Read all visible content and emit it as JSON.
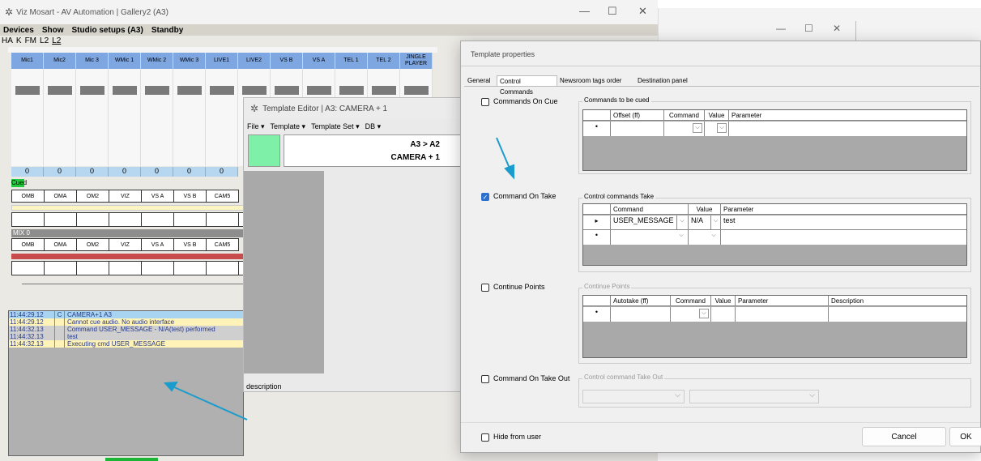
{
  "main_window": {
    "title": "Viz Mosart - AV Automation | Gallery2 (A3)",
    "menu": [
      "Devices",
      "Show",
      "Studio setups (A3)",
      "Standby"
    ],
    "subbar": [
      "HA",
      "K",
      "FM",
      "L2",
      "L2"
    ],
    "channels": [
      "Mic1",
      "Mic2",
      "Mic 3",
      "WMic 1",
      "WMic 2",
      "WMic 3",
      "LIVE1",
      "LIVE2",
      "VS B",
      "VS A",
      "TEL 1",
      "TEL 2",
      "JINGLE PLAYER"
    ],
    "channel_values": [
      "0",
      "0",
      "0",
      "0",
      "0",
      "0",
      "0"
    ],
    "cued_label": "Cued",
    "cued_buttons": [
      "OMB",
      "OMA",
      "OM2",
      "VIZ",
      "VS A",
      "VS B",
      "CAM5"
    ],
    "mix_label": "MIX 0",
    "mix_buttons": [
      "OMB",
      "OMA",
      "OM2",
      "VIZ",
      "VS A",
      "VS B",
      "CAM5"
    ]
  },
  "log": {
    "rows": [
      {
        "time": "11:44:29.12",
        "code": "C",
        "msg": "CAMERA+1 A3",
        "bg": "#a8d4f2"
      },
      {
        "time": "11:44:29.12",
        "code": "",
        "msg": "Cannot cue audio. No audio interface",
        "bg": "#fff3b8"
      },
      {
        "time": "11:44:32.13",
        "code": "",
        "msg": "Command USER_MESSAGE - N/A(test) performed",
        "bg": "#cfcfcf"
      },
      {
        "time": "11:44:32.13",
        "code": "",
        "msg": "test",
        "bg": "#cfcfcf"
      },
      {
        "time": "11:44:32.13",
        "code": "",
        "msg": "Executing cmd USER_MESSAGE",
        "bg": "#fff3b8"
      }
    ]
  },
  "template_editor": {
    "title": "Template Editor | A3: CAMERA + 1",
    "menu": [
      "File ▾",
      "Template ▾",
      "Template Set ▾",
      "DB ▾"
    ],
    "line1": "A3 > A2",
    "line2": "CAMERA + 1",
    "description_label": "description"
  },
  "dialog": {
    "title": "Template properties",
    "tabs": [
      "General",
      "Control Commands",
      "Newsroom tags order",
      "Destination panel"
    ],
    "active_tab": "Control Commands",
    "sections": {
      "cue": {
        "label": "Commands On Cue",
        "checked": false,
        "group_title": "Commands to be cued",
        "headers": [
          "Offset (ff)",
          "Command",
          "Value",
          "Parameter"
        ]
      },
      "take": {
        "label": "Command On Take",
        "checked": true,
        "group_title": "Control commands Take",
        "headers": [
          "Command",
          "Value",
          "Parameter"
        ],
        "row": {
          "command": "USER_MESSAGE",
          "value": "N/A",
          "parameter": "test"
        }
      },
      "continue": {
        "label": "Continue Points",
        "checked": false,
        "group_title": "Continue Points",
        "headers": [
          "Autotake (ff)",
          "Command",
          "Value",
          "Parameter",
          "Description"
        ]
      },
      "take_out": {
        "label": "Command On Take Out",
        "checked": false,
        "group_title": "Control command Take Out"
      }
    },
    "hide_label": "Hide from user",
    "cancel_label": "Cancel",
    "ok_label": "OK"
  },
  "colors": {
    "accent": "#2b6fcf",
    "arrow": "#1a9ccc",
    "channel_header": "#7ea6e0"
  },
  "icons": {
    "app_logo": "snowflake-logo-icon",
    "arrow": "annotation-arrow-icon"
  }
}
